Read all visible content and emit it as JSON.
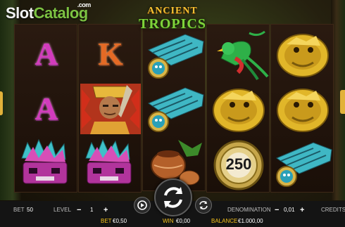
{
  "watermark": {
    "part1": "Slot",
    "part2": "Catalog",
    "suffix": ".com"
  },
  "game_logo": {
    "line1": "ANCIENT",
    "line2": "TROPICS"
  },
  "reels": [
    [
      "A",
      "A",
      "purple-quetzal-headdress"
    ],
    [
      "K",
      "aztec-chief-warrior",
      "purple-quetzal-headdress"
    ],
    [
      "turquoise-skull-necklace",
      "turquoise-skull-necklace",
      "clay-pot"
    ],
    [
      "quetzal-bird",
      "golden-dragon",
      "golden-calendar-250"
    ],
    [
      "golden-dragon",
      "golden-dragon",
      "turquoise-skull-necklace"
    ]
  ],
  "calendar_value": "250",
  "footer": {
    "bet_label": "BET",
    "bet_value": "50",
    "level_label": "LEVEL",
    "level_value": "1",
    "denomination_label": "DENOMINATION",
    "denomination_value": "0,01",
    "credits_label": "CREDITS",
    "bet_money_label": "BET",
    "bet_money_value": "€0,50",
    "win_label": "WIN",
    "win_value": "€0,00",
    "balance_label": "BALANCE",
    "balance_value": "€1.000,00",
    "minus": "−",
    "plus": "+"
  },
  "colors": {
    "accent_gold": "#f5c21b",
    "letter_pink": "#d23bbd",
    "letter_orange": "#e46a25",
    "bar_bg": "#141414"
  }
}
